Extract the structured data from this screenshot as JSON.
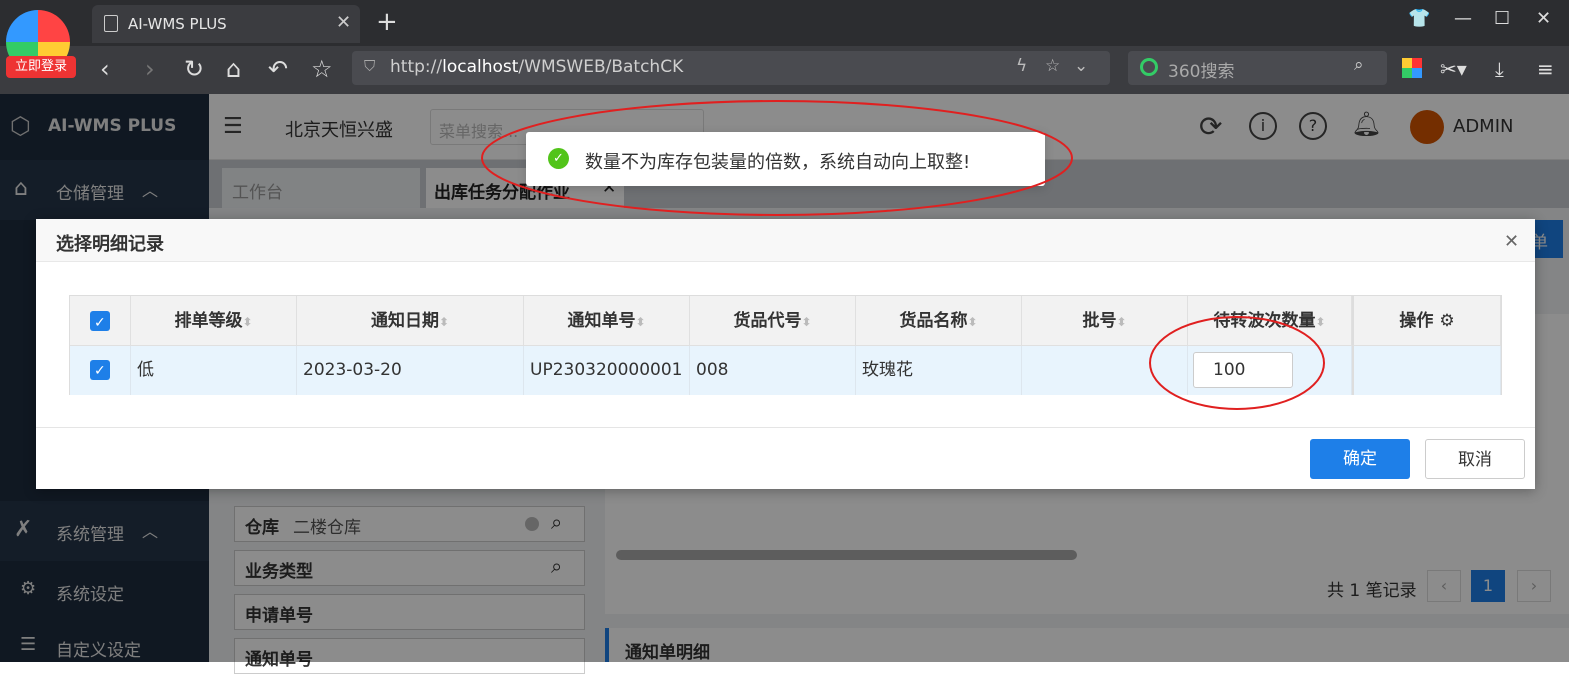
{
  "browser": {
    "tab_title": "AI-WMS PLUS",
    "login_badge": "立即登录",
    "url_prefix": "http://",
    "url_host": "localhost",
    "url_path": "/WMSWEB/BatchCK",
    "search_placeholder": "360搜索"
  },
  "app": {
    "logo_text": "AI-WMS PLUS",
    "company": "北京天恒兴盛",
    "menu_search_placeholder": "菜单搜索...",
    "user": "ADMIN",
    "tabs": [
      "工作台",
      "出库任务分配作业"
    ]
  },
  "sidebar": {
    "group1": "仓储管理",
    "group2": "系统管理",
    "items": [
      "系统设定",
      "自定义设定"
    ]
  },
  "filters": {
    "warehouse_label": "仓库",
    "warehouse_value": "二楼仓库",
    "biz_type_label": "业务类型",
    "request_no_label": "申请单号",
    "notice_no_label": "通知单号"
  },
  "pager": {
    "total": "共 1 笔记录",
    "page": "1"
  },
  "detail_title": "通知单明细",
  "right_btn_fragment": "单",
  "dialog": {
    "title": "选择明细记录",
    "columns": [
      "排单等级",
      "通知日期",
      "通知单号",
      "货品代号",
      "货品名称",
      "批号",
      "待转波次数量",
      "操作"
    ],
    "row": {
      "level": "低",
      "date": "2023-03-20",
      "notice_no": "UP230320000001",
      "code": "008",
      "name": "玫瑰花",
      "batch": "",
      "qty": "100",
      "op": ""
    },
    "confirm": "确定",
    "cancel": "取消"
  },
  "toast": "数量不为库存包装量的倍数，系统自动向上取整!",
  "colors": {
    "primary": "#1e7fe8",
    "sidebar": "#1e2c3f",
    "annotation": "#e02020",
    "success": "#52c41a"
  }
}
